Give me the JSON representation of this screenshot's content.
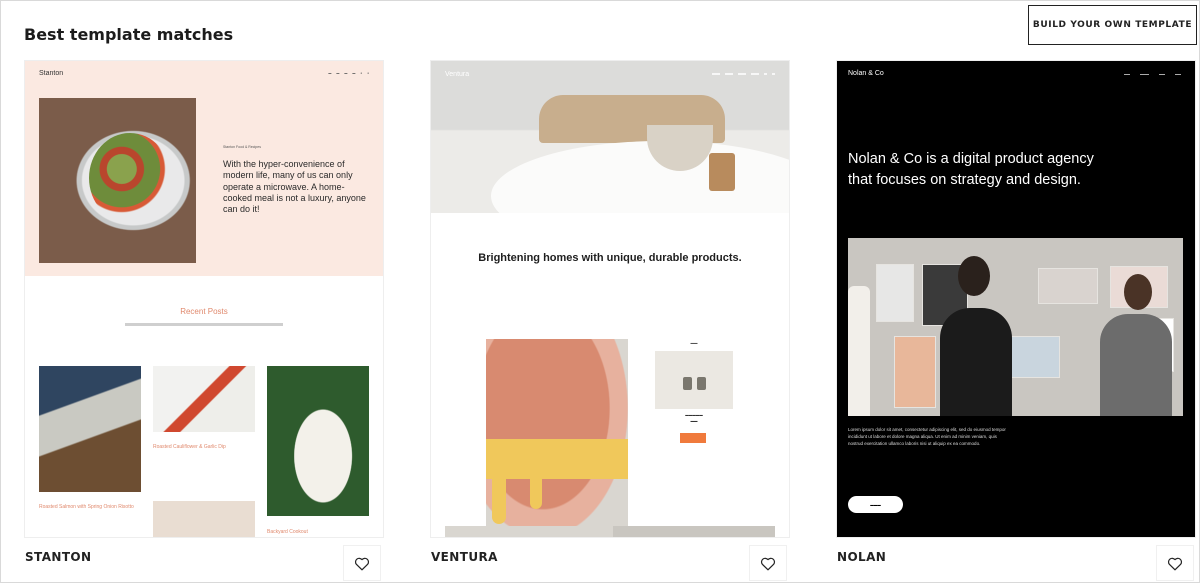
{
  "page": {
    "title": "Best template matches",
    "build_button": "BUILD YOUR OWN TEMPLATE"
  },
  "templates": [
    {
      "label": "STANTON",
      "preview": {
        "brand": "Stanton",
        "kicker": "Stanton Food & Recipes",
        "blurb": "With the hyper-convenience of modern life, many of us can only operate a microwave. A home-cooked meal is not a luxury, anyone can do it!",
        "section_title": "Recent Posts",
        "post_1": "Roasted Salmon with Spring Onion Risotto",
        "post_2": "Roasted Cauliflower & Garlic Dip",
        "post_3": "Backyard Cookout"
      }
    },
    {
      "label": "VENTURA",
      "preview": {
        "brand": "Ventura",
        "headline": "Brightening homes with unique, durable products."
      }
    },
    {
      "label": "NOLAN",
      "preview": {
        "brand": "Nolan & Co",
        "headline": "Nolan & Co is a digital product agency that focuses on strategy and design.",
        "body": "Lorem ipsum dolor sit amet, consectetur adipiscing elit, sed do eiusmod tempor incididunt ut labore et dolore magna aliqua. Ut enim ad minim veniam, quis nostrud exercitation ullamco laboris nisi ut aliquip ex ea commodo."
      }
    }
  ],
  "icons": {
    "favorite": "heart-icon"
  }
}
